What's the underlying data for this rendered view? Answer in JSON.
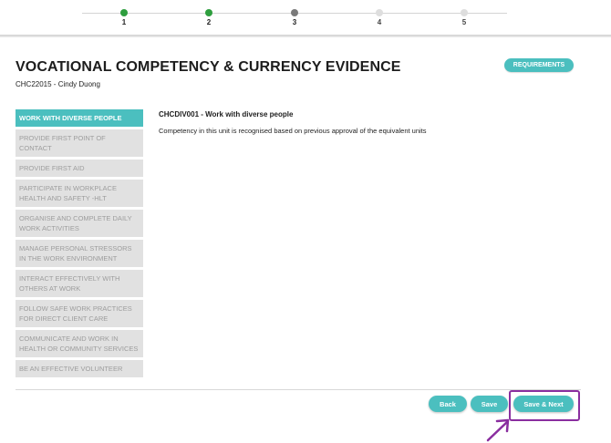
{
  "stepper": {
    "steps": [
      {
        "label": "1",
        "state": "done"
      },
      {
        "label": "2",
        "state": "done"
      },
      {
        "label": "3",
        "state": "current"
      },
      {
        "label": "4",
        "state": "todo"
      },
      {
        "label": "5",
        "state": "todo"
      }
    ]
  },
  "page": {
    "title": "VOCATIONAL COMPETENCY & CURRENCY EVIDENCE",
    "subtitle": "CHC22015 - Cindy Duong",
    "requirements_label": "REQUIREMENTS"
  },
  "sidebar": {
    "items": [
      {
        "label": "WORK WITH DIVERSE PEOPLE",
        "active": true
      },
      {
        "label": "PROVIDE FIRST POINT OF CONTACT",
        "active": false
      },
      {
        "label": "PROVIDE FIRST AID",
        "active": false
      },
      {
        "label": "PARTICIPATE IN WORKPLACE HEALTH AND SAFETY -HLT",
        "active": false
      },
      {
        "label": "ORGANISE AND COMPLETE DAILY WORK ACTIVITIES",
        "active": false
      },
      {
        "label": "MANAGE PERSONAL STRESSORS IN THE WORK ENVIRONMENT",
        "active": false
      },
      {
        "label": "INTERACT EFFECTIVELY WITH OTHERS AT WORK",
        "active": false
      },
      {
        "label": "FOLLOW SAFE WORK PRACTICES FOR DIRECT CLIENT CARE",
        "active": false
      },
      {
        "label": "COMMUNICATE AND WORK IN HEALTH OR COMMUNITY SERVICES",
        "active": false
      },
      {
        "label": "BE AN EFFECTIVE VOLUNTEER",
        "active": false
      }
    ]
  },
  "main": {
    "unit_title": "CHCDIV001 - Work with diverse people",
    "unit_description": "Competency in this unit is recognised based on previous approval of the equivalent units"
  },
  "footer": {
    "back_label": "Back",
    "save_label": "Save",
    "save_next_label": "Save & Next"
  },
  "colors": {
    "accent": "#4bbfbf",
    "step_done": "#2e9e3e",
    "highlight": "#8a2e9f"
  }
}
